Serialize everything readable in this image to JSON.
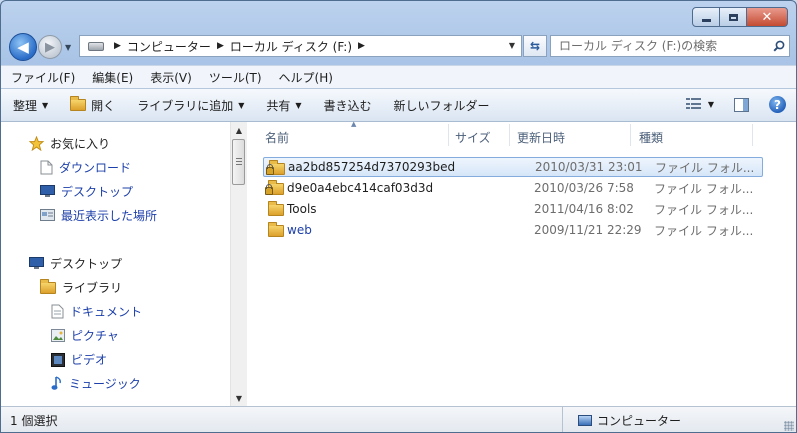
{
  "window": {
    "caption_min": "minimize",
    "caption_max": "maximize",
    "close_glyph": "✕"
  },
  "nav": {
    "back_glyph": "◀",
    "forward_glyph": "▶",
    "breadcrumb": [
      "コンピューター",
      "ローカル ディスク (F:)"
    ],
    "search_placeholder": "ローカル ディスク (F:)の検索"
  },
  "menu": [
    "ファイル(F)",
    "編集(E)",
    "表示(V)",
    "ツール(T)",
    "ヘルプ(H)"
  ],
  "commands": {
    "organize": "整理",
    "open": "開く",
    "add_library": "ライブラリに追加",
    "share": "共有",
    "burn": "書き込む",
    "new_folder": "新しいフォルダー",
    "help": "?"
  },
  "sidebar": {
    "favorites": "お気に入り",
    "downloads": "ダウンロード",
    "desktop_fav": "デスクトップ",
    "recent": "最近表示した場所",
    "desktop": "デスクトップ",
    "libraries": "ライブラリ",
    "documents": "ドキュメント",
    "pictures": "ピクチャ",
    "videos": "ビデオ",
    "music": "ミュージック"
  },
  "columns": {
    "name": "名前",
    "size": "サイズ",
    "modified": "更新日時",
    "type": "種類"
  },
  "files": [
    {
      "name": "aa2bd857254d7370293bed",
      "date": "2010/03/31 23:01",
      "type": "ファイル フォル...",
      "locked": true,
      "selected": true
    },
    {
      "name": "d9e0a4ebc414caf03d3d",
      "date": "2010/03/26 7:58",
      "type": "ファイル フォル...",
      "locked": true,
      "selected": false
    },
    {
      "name": "Tools",
      "date": "2011/04/16 8:02",
      "type": "ファイル フォル...",
      "locked": false,
      "selected": false
    },
    {
      "name": "web",
      "date": "2009/11/21 22:29",
      "type": "ファイル フォル...",
      "locked": false,
      "selected": false
    }
  ],
  "status": {
    "selection": "1 個選択",
    "location": "コンピューター"
  },
  "colors": {
    "accent": "#1c3faa",
    "selection_bg": "#d6e6f8",
    "selection_border": "#84acdd"
  }
}
